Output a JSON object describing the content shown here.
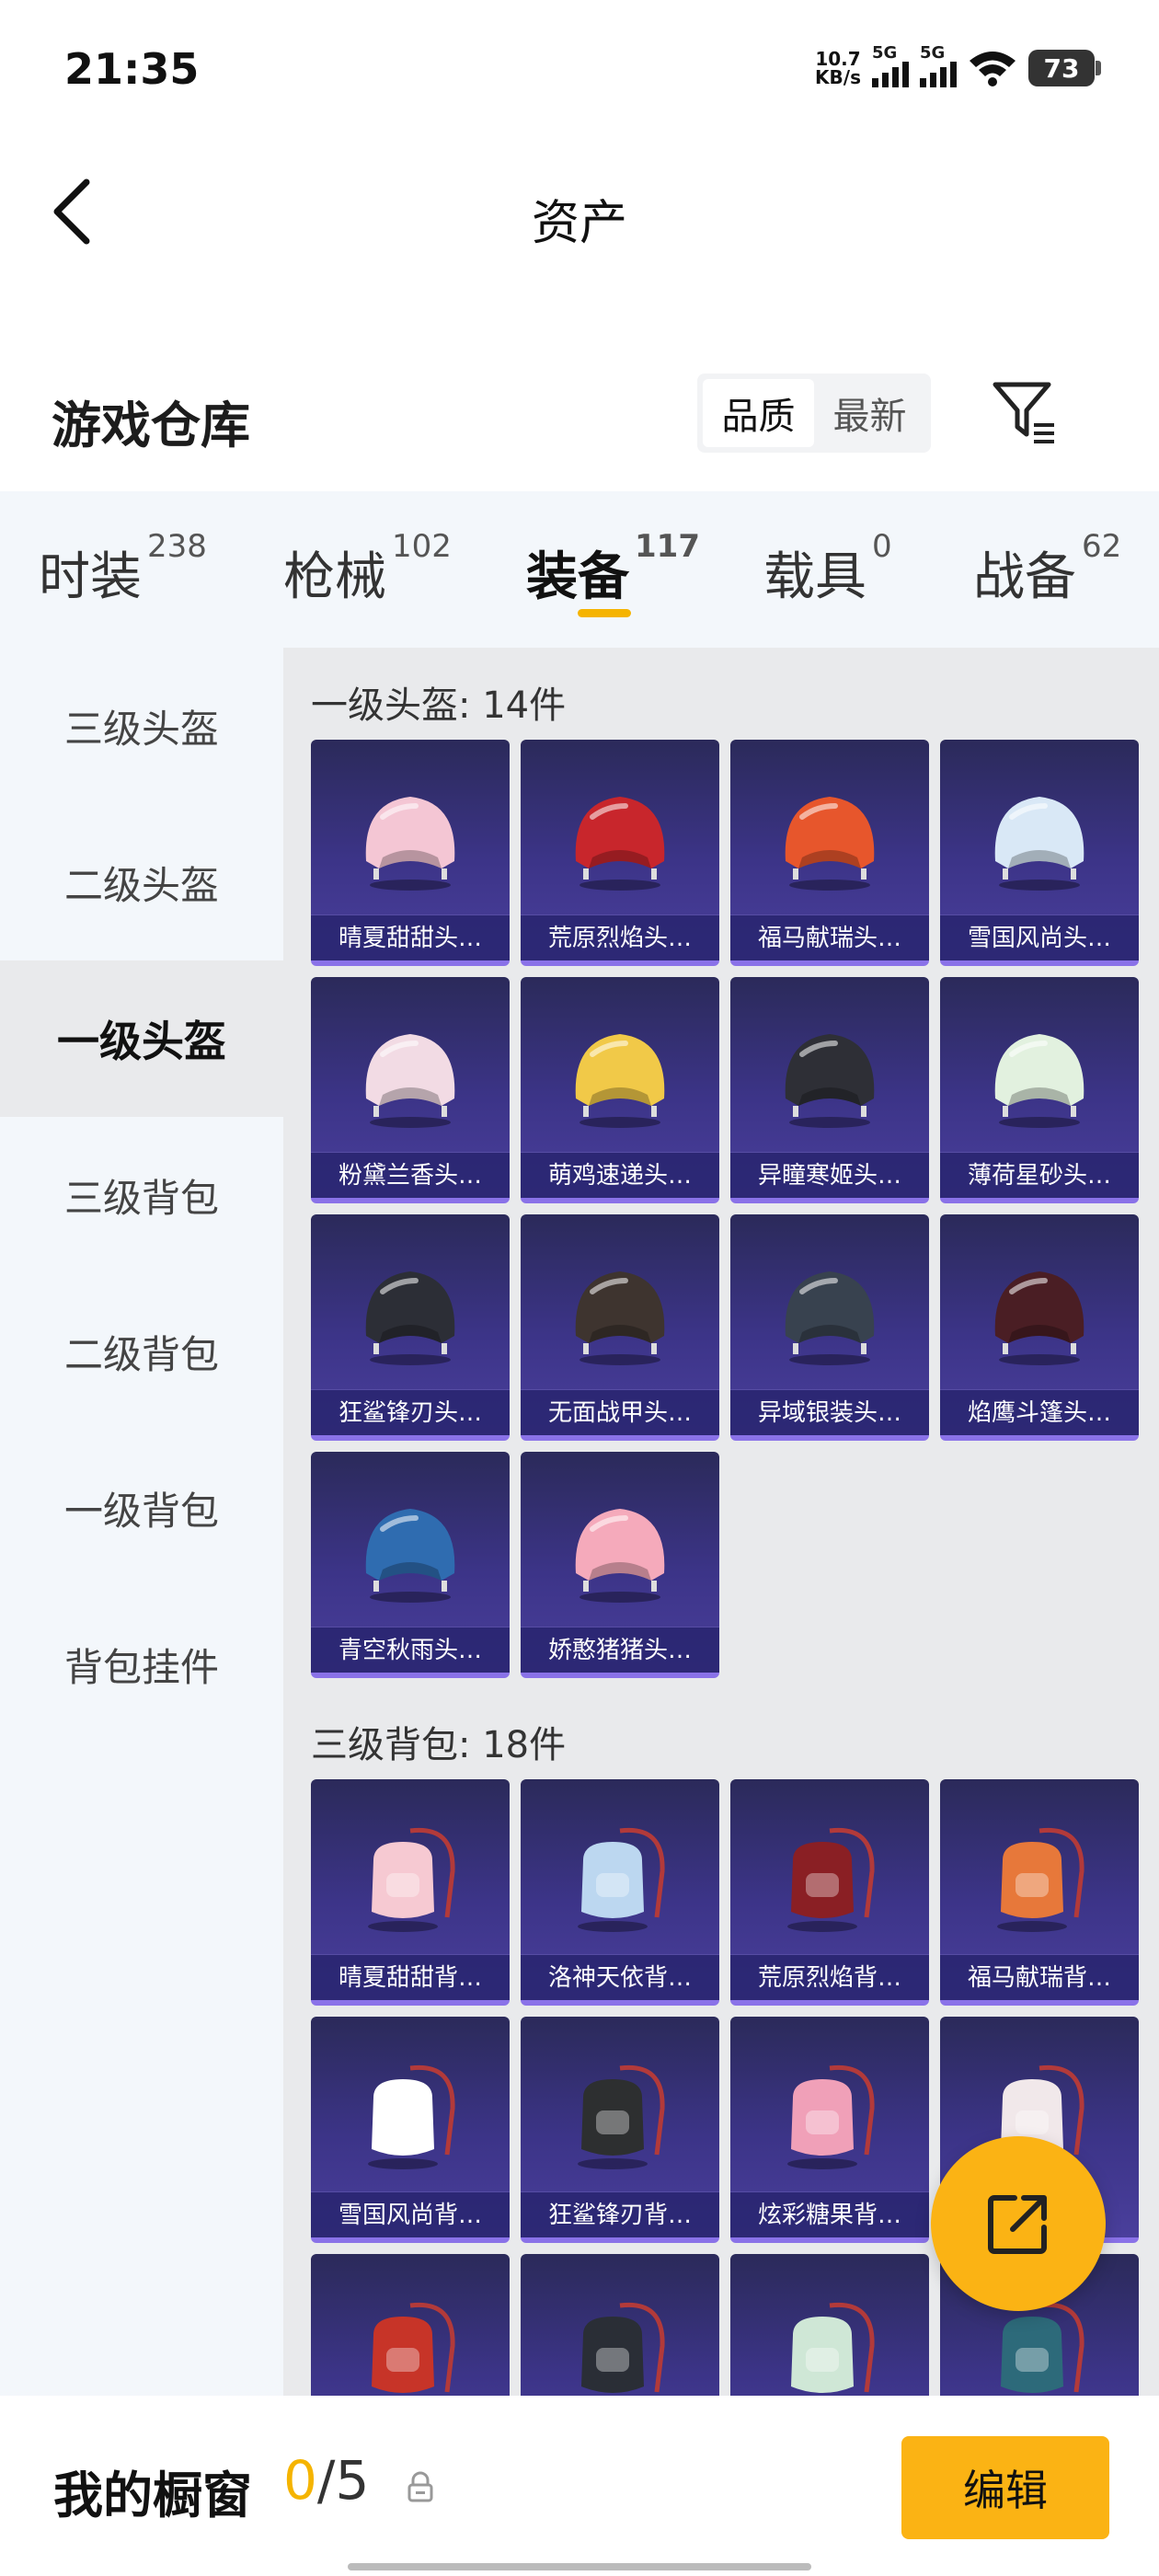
{
  "status": {
    "time": "21:35",
    "net_speed_value": "10.7",
    "net_speed_unit": "KB/s",
    "sim1": "5G",
    "sim2": "5G",
    "battery": "73"
  },
  "header": {
    "title": "资产"
  },
  "warehouse": {
    "title": "游戏仓库",
    "sort_quality": "品质",
    "sort_latest": "最新"
  },
  "tabs": [
    {
      "label": "时装",
      "count": "238"
    },
    {
      "label": "枪械",
      "count": "102"
    },
    {
      "label": "装备",
      "count": "117"
    },
    {
      "label": "载具",
      "count": "0"
    },
    {
      "label": "战备",
      "count": "62"
    }
  ],
  "sidebar": [
    "三级头盔",
    "二级头盔",
    "一级头盔",
    "三级背包",
    "二级背包",
    "一级背包",
    "背包挂件"
  ],
  "sections": [
    {
      "title": "一级头盔: 14件",
      "items": [
        "晴夏甜甜头…",
        "荒原烈焰头…",
        "福马献瑞头…",
        "雪国风尚头…",
        "粉黛兰香头…",
        "萌鸡速递头…",
        "异瞳寒姬头…",
        "薄荷星砂头…",
        "狂鲨锋刃头…",
        "无面战甲头…",
        "异域银装头…",
        "焰鹰斗篷头…",
        "青空秋雨头…",
        "娇憨猪猪头…"
      ]
    },
    {
      "title": "三级背包: 18件",
      "items": [
        "晴夏甜甜背…",
        "洛神天依背…",
        "荒原烈焰背…",
        "福马献瑞背…",
        "雪国风尚背…",
        "狂鲨锋刃背…",
        "炫彩糖果背…",
        "",
        "",
        "",
        "",
        ""
      ]
    }
  ],
  "showcase": {
    "label": "我的橱窗",
    "current": "0",
    "max": "/5",
    "edit": "编辑"
  }
}
